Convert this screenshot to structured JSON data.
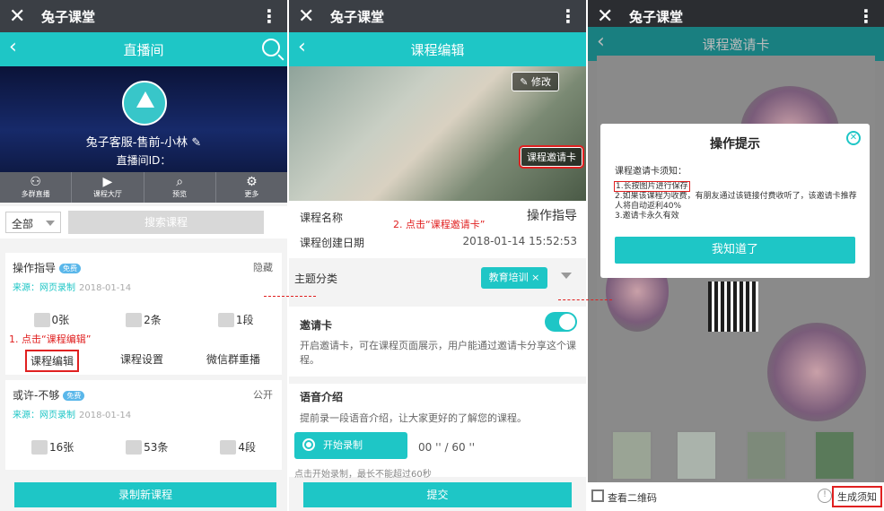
{
  "panel1": {
    "appbar_title": "兔子课堂",
    "nav_title": "直播间",
    "host_name": "兔子客服-售前-小林",
    "room_id_label": "直播间ID：",
    "tools": [
      "多群直播",
      "课程大厅",
      "预览",
      "更多"
    ],
    "filter_value": "全部",
    "search_button": "搜索课程",
    "courses": [
      {
        "title": "操作指导",
        "tag": "免费",
        "status": "隐藏",
        "source_label": "来源：",
        "source": "网页录制",
        "date": "2018-01-14",
        "stats": [
          "0张",
          "2条",
          "1段"
        ],
        "actions": [
          "课程编辑",
          "课程设置",
          "微信群重播"
        ]
      },
      {
        "title": "或许-不够",
        "tag": "免费",
        "status": "公开",
        "source_label": "来源：",
        "source": "网页录制",
        "date": "2018-01-14",
        "stats": [
          "16张",
          "53条",
          "4段"
        ]
      }
    ],
    "annotation": "1. 点击“课程编辑”",
    "bottom_button": "录制新课程"
  },
  "panel2": {
    "appbar_title": "兔子课堂",
    "nav_title": "课程编辑",
    "edit_button": "修改",
    "invite_button": "课程邀请卡",
    "annotation": "2. 点击“课程邀请卡”",
    "course_name_label": "课程名称",
    "course_name_value": "操作指导",
    "created_label": "课程创建日期",
    "created_value": "2018-01-14 15:52:53",
    "topic_label": "主题分类",
    "topic_chip": "教育培训",
    "invite_label": "邀请卡",
    "invite_desc": "开启邀请卡，可在课程页面展示，用户能通过邀请卡分享这个课程。",
    "voice_label": "语音介绍",
    "voice_desc": "提前录一段语音介绍，让大家更好的了解您的课程。",
    "record_button": "开始录制",
    "record_time": "00 '' / 60 ''",
    "record_hint": "点击开始录制，最长不能超过60秒",
    "submit_button": "提交"
  },
  "panel3": {
    "appbar_title": "兔子课堂",
    "nav_title": "课程邀请卡",
    "modal_title": "操作提示",
    "modal_heading": "课程邀请卡须知：",
    "modal_line1": "1.长按图片进行保存",
    "modal_line2": "2.如果该课程为收费，有朋友通过该链接付费收听了，该邀请卡推荐人将自动返利40%",
    "modal_line3": "3.邀请卡永久有效",
    "modal_button": "我知道了",
    "view_qr": "查看二维码",
    "generate_notice": "生成须知"
  },
  "colors": {
    "accent": "#1ec6c6",
    "appbar": "#3b3f45",
    "annotation": "#e02020"
  }
}
